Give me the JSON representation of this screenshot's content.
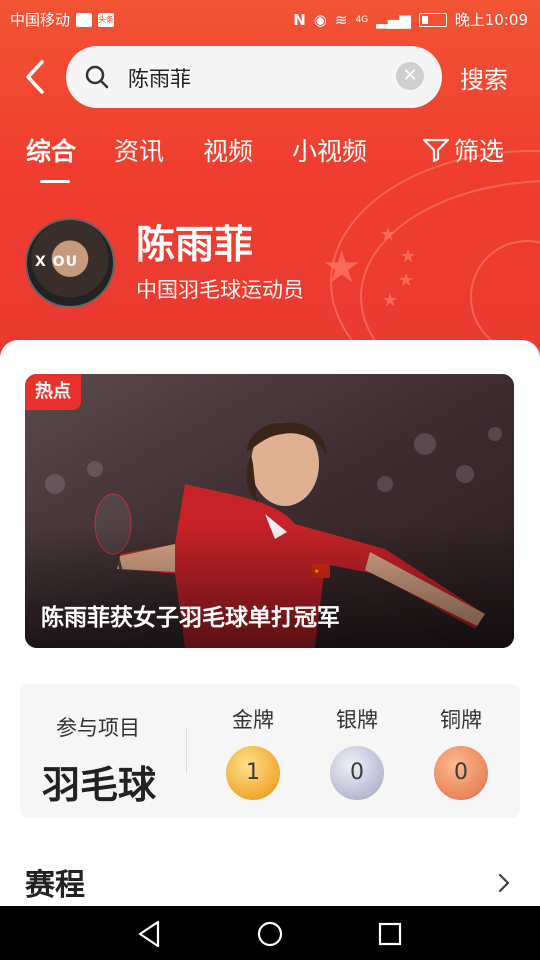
{
  "status_bar": {
    "carrier": "中国移动",
    "badge_1": "",
    "badge_2": "头条",
    "network": "4G",
    "time": "晚上10:09"
  },
  "search": {
    "query": "陈雨菲",
    "search_button": "搜索"
  },
  "tabs": [
    {
      "label": "综合",
      "active": true
    },
    {
      "label": "资讯",
      "active": false
    },
    {
      "label": "视频",
      "active": false
    },
    {
      "label": "小视频",
      "active": false
    }
  ],
  "filter": {
    "label": "筛选"
  },
  "athlete": {
    "name": "陈雨菲",
    "description": "中国羽毛球运动员",
    "avatar_text": "X OU"
  },
  "news_card": {
    "tag": "热点",
    "caption": "陈雨菲获女子羽毛球单打冠军"
  },
  "medals": {
    "sport_label": "参与项目",
    "sport_name": "羽毛球",
    "gold_label": "金牌",
    "gold_count": "1",
    "silver_label": "银牌",
    "silver_count": "0",
    "bronze_label": "铜牌",
    "bronze_count": "0"
  },
  "schedule": {
    "title": "赛程"
  },
  "colors": {
    "accent": "#ef3d2f",
    "tag": "#e8312b"
  }
}
